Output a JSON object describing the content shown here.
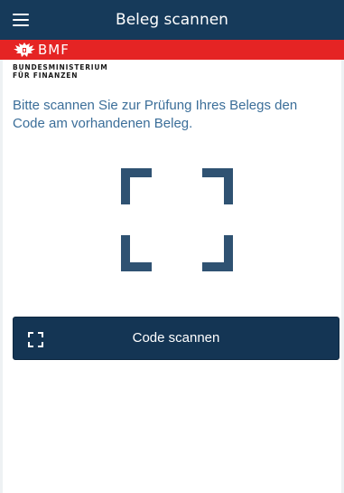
{
  "header": {
    "title": "Beleg scannen",
    "menu_icon": "hamburger-menu-icon"
  },
  "brand": {
    "abbreviation": "BMF",
    "ministry_line1": "BUNDESMINISTERIUM",
    "ministry_line2": "FÜR FINANZEN",
    "logo_icon": "federal-eagle-icon",
    "bar_color": "#e52424"
  },
  "main": {
    "instruction": "Bitte scannen Sie zur Prüfung Ihres Belegs den Code am vorhandenen Beleg.",
    "scan_frame_icon": "scan-frame-icon"
  },
  "scan_button": {
    "label": "Code scannen",
    "icon": "scan-corners-icon"
  },
  "colors": {
    "header_bg": "#163a5a",
    "accent_text": "#3b6e99",
    "scan_frame": "#2f5272",
    "button_bg": "#143554"
  }
}
